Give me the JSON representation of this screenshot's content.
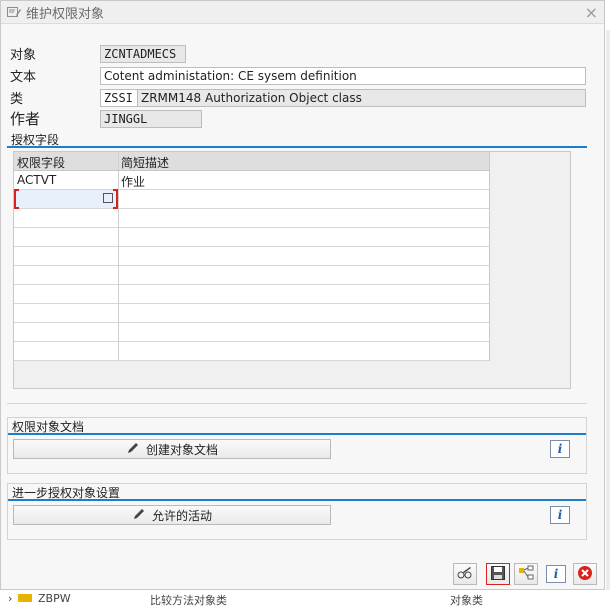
{
  "dialog": {
    "title": "维护权限对象",
    "close": "×"
  },
  "header": {
    "object_label": "对象",
    "object_value": "ZCNTADMECS",
    "text_label": "文本",
    "text_value": "Cotent administation: CE sysem definition",
    "class_label": "类",
    "class_code": "ZSSI",
    "class_desc": "ZRMM148 Authorization Object class",
    "author_label": "作者",
    "author_value": "JINGGL"
  },
  "auth_fields": {
    "title": "授权字段",
    "columns": [
      "权限字段",
      "简短描述"
    ],
    "rows": [
      {
        "field": "ACTVT",
        "desc": "作业"
      },
      {
        "field": "",
        "desc": ""
      },
      {
        "field": "",
        "desc": ""
      },
      {
        "field": "",
        "desc": ""
      },
      {
        "field": "",
        "desc": ""
      },
      {
        "field": "",
        "desc": ""
      },
      {
        "field": "",
        "desc": ""
      },
      {
        "field": "",
        "desc": ""
      },
      {
        "field": "",
        "desc": ""
      },
      {
        "field": "",
        "desc": ""
      }
    ]
  },
  "docs": {
    "title": "权限对象文档",
    "create_button": "创建对象文档",
    "info": "i"
  },
  "further": {
    "title": "进一步授权对象设置",
    "activities_button": "允许的活动",
    "info": "i"
  },
  "footer": {
    "info": "i"
  },
  "background": {
    "row_text_1": "ZBPW",
    "row_text_2": "比较方法对象类",
    "row_text_3": "对象类"
  },
  "colors": {
    "accent": "#1f7cc8",
    "focus": "#d9221f",
    "cancel": "#d9221f"
  }
}
